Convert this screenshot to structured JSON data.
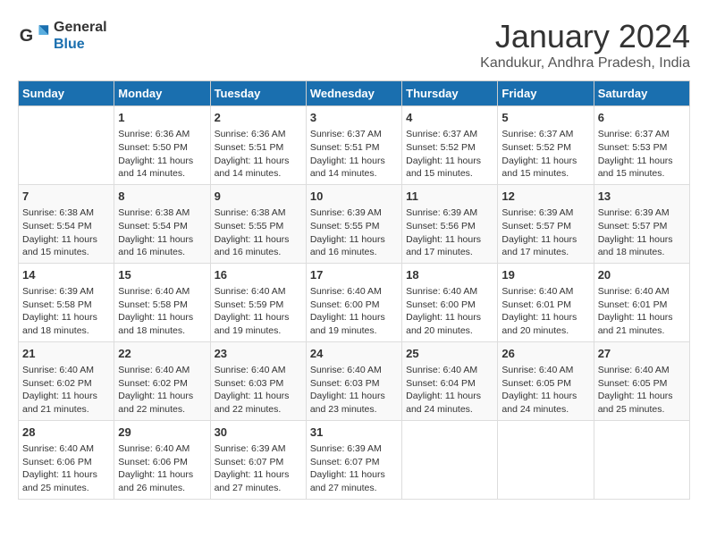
{
  "header": {
    "logo_general": "General",
    "logo_blue": "Blue",
    "month_title": "January 2024",
    "location": "Kandukur, Andhra Pradesh, India"
  },
  "days_of_week": [
    "Sunday",
    "Monday",
    "Tuesday",
    "Wednesday",
    "Thursday",
    "Friday",
    "Saturday"
  ],
  "weeks": [
    [
      {
        "day": "",
        "content": ""
      },
      {
        "day": "1",
        "content": "Sunrise: 6:36 AM\nSunset: 5:50 PM\nDaylight: 11 hours\nand 14 minutes."
      },
      {
        "day": "2",
        "content": "Sunrise: 6:36 AM\nSunset: 5:51 PM\nDaylight: 11 hours\nand 14 minutes."
      },
      {
        "day": "3",
        "content": "Sunrise: 6:37 AM\nSunset: 5:51 PM\nDaylight: 11 hours\nand 14 minutes."
      },
      {
        "day": "4",
        "content": "Sunrise: 6:37 AM\nSunset: 5:52 PM\nDaylight: 11 hours\nand 15 minutes."
      },
      {
        "day": "5",
        "content": "Sunrise: 6:37 AM\nSunset: 5:52 PM\nDaylight: 11 hours\nand 15 minutes."
      },
      {
        "day": "6",
        "content": "Sunrise: 6:37 AM\nSunset: 5:53 PM\nDaylight: 11 hours\nand 15 minutes."
      }
    ],
    [
      {
        "day": "7",
        "content": "Sunrise: 6:38 AM\nSunset: 5:54 PM\nDaylight: 11 hours\nand 15 minutes."
      },
      {
        "day": "8",
        "content": "Sunrise: 6:38 AM\nSunset: 5:54 PM\nDaylight: 11 hours\nand 16 minutes."
      },
      {
        "day": "9",
        "content": "Sunrise: 6:38 AM\nSunset: 5:55 PM\nDaylight: 11 hours\nand 16 minutes."
      },
      {
        "day": "10",
        "content": "Sunrise: 6:39 AM\nSunset: 5:55 PM\nDaylight: 11 hours\nand 16 minutes."
      },
      {
        "day": "11",
        "content": "Sunrise: 6:39 AM\nSunset: 5:56 PM\nDaylight: 11 hours\nand 17 minutes."
      },
      {
        "day": "12",
        "content": "Sunrise: 6:39 AM\nSunset: 5:57 PM\nDaylight: 11 hours\nand 17 minutes."
      },
      {
        "day": "13",
        "content": "Sunrise: 6:39 AM\nSunset: 5:57 PM\nDaylight: 11 hours\nand 18 minutes."
      }
    ],
    [
      {
        "day": "14",
        "content": "Sunrise: 6:39 AM\nSunset: 5:58 PM\nDaylight: 11 hours\nand 18 minutes."
      },
      {
        "day": "15",
        "content": "Sunrise: 6:40 AM\nSunset: 5:58 PM\nDaylight: 11 hours\nand 18 minutes."
      },
      {
        "day": "16",
        "content": "Sunrise: 6:40 AM\nSunset: 5:59 PM\nDaylight: 11 hours\nand 19 minutes."
      },
      {
        "day": "17",
        "content": "Sunrise: 6:40 AM\nSunset: 6:00 PM\nDaylight: 11 hours\nand 19 minutes."
      },
      {
        "day": "18",
        "content": "Sunrise: 6:40 AM\nSunset: 6:00 PM\nDaylight: 11 hours\nand 20 minutes."
      },
      {
        "day": "19",
        "content": "Sunrise: 6:40 AM\nSunset: 6:01 PM\nDaylight: 11 hours\nand 20 minutes."
      },
      {
        "day": "20",
        "content": "Sunrise: 6:40 AM\nSunset: 6:01 PM\nDaylight: 11 hours\nand 21 minutes."
      }
    ],
    [
      {
        "day": "21",
        "content": "Sunrise: 6:40 AM\nSunset: 6:02 PM\nDaylight: 11 hours\nand 21 minutes."
      },
      {
        "day": "22",
        "content": "Sunrise: 6:40 AM\nSunset: 6:02 PM\nDaylight: 11 hours\nand 22 minutes."
      },
      {
        "day": "23",
        "content": "Sunrise: 6:40 AM\nSunset: 6:03 PM\nDaylight: 11 hours\nand 22 minutes."
      },
      {
        "day": "24",
        "content": "Sunrise: 6:40 AM\nSunset: 6:03 PM\nDaylight: 11 hours\nand 23 minutes."
      },
      {
        "day": "25",
        "content": "Sunrise: 6:40 AM\nSunset: 6:04 PM\nDaylight: 11 hours\nand 24 minutes."
      },
      {
        "day": "26",
        "content": "Sunrise: 6:40 AM\nSunset: 6:05 PM\nDaylight: 11 hours\nand 24 minutes."
      },
      {
        "day": "27",
        "content": "Sunrise: 6:40 AM\nSunset: 6:05 PM\nDaylight: 11 hours\nand 25 minutes."
      }
    ],
    [
      {
        "day": "28",
        "content": "Sunrise: 6:40 AM\nSunset: 6:06 PM\nDaylight: 11 hours\nand 25 minutes."
      },
      {
        "day": "29",
        "content": "Sunrise: 6:40 AM\nSunset: 6:06 PM\nDaylight: 11 hours\nand 26 minutes."
      },
      {
        "day": "30",
        "content": "Sunrise: 6:39 AM\nSunset: 6:07 PM\nDaylight: 11 hours\nand 27 minutes."
      },
      {
        "day": "31",
        "content": "Sunrise: 6:39 AM\nSunset: 6:07 PM\nDaylight: 11 hours\nand 27 minutes."
      },
      {
        "day": "",
        "content": ""
      },
      {
        "day": "",
        "content": ""
      },
      {
        "day": "",
        "content": ""
      }
    ]
  ]
}
